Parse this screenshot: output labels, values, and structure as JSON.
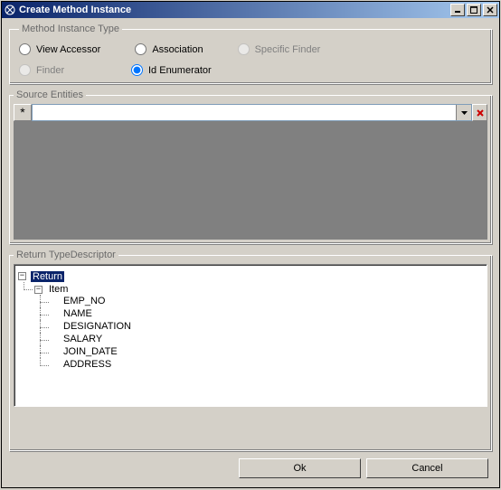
{
  "window": {
    "title": "Create Method Instance"
  },
  "groups": {
    "method_instance_type": {
      "legend": "Method Instance Type",
      "options": {
        "view_accessor": "View Accessor",
        "association": "Association",
        "specific_finder": "Specific Finder",
        "finder": "Finder",
        "id_enumerator": "Id Enumerator"
      },
      "selected": "id_enumerator"
    },
    "source_entities": {
      "legend": "Source Entities",
      "new_row_marker": "*"
    },
    "return_type_descriptor": {
      "legend": "Return TypeDescriptor",
      "tree": {
        "root": {
          "label": "Return",
          "expanded": true,
          "selected": true
        },
        "item": {
          "label": "Item",
          "expanded": true
        },
        "fields": [
          "EMP_NO",
          "NAME",
          "DESIGNATION",
          "SALARY",
          "JOIN_DATE",
          "ADDRESS"
        ]
      }
    }
  },
  "buttons": {
    "ok": "Ok",
    "cancel": "Cancel"
  },
  "icons": {
    "minimize": "_",
    "maximize": "□",
    "close": "✕",
    "dropdown": "▾",
    "delete": "✕",
    "minus": "−"
  }
}
